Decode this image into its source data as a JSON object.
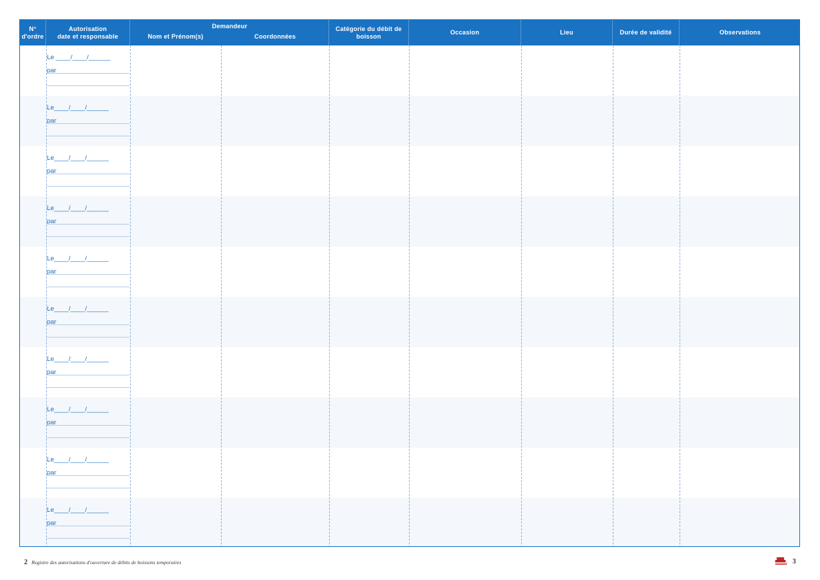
{
  "header": {
    "num": [
      "N°",
      "d'ordre"
    ],
    "autorisation": [
      "Autorisation",
      "date et responsable"
    ],
    "demandeur": "Demandeur",
    "nom": "Nom et Prénom(s)",
    "coordonnees": "Coordonnées",
    "categorie": [
      "Catégorie du débit de",
      "boisson"
    ],
    "occasion": "Occasion",
    "lieu": "Lieu",
    "duree": "Durée de validité",
    "observations": "Observations"
  },
  "rows": [
    {
      "le": "Le ____/____/______",
      "par": "par"
    },
    {
      "le": "Le____/____/______",
      "par": "par"
    },
    {
      "le": "Le____/____/______",
      "par": "par"
    },
    {
      "le": "Le____/____/______",
      "par": "par"
    },
    {
      "le": "Le____/____/______",
      "par": "par"
    },
    {
      "le": "Le____/____/______",
      "par": "par"
    },
    {
      "le": "Le____/____/______",
      "par": "par"
    },
    {
      "le": "Le____/____/______",
      "par": "par"
    },
    {
      "le": "Le____/____/______",
      "par": "par"
    },
    {
      "le": "Le____/____/______",
      "par": "par"
    }
  ],
  "footer": {
    "left_page": "2",
    "title": "Registre des autorisations d'ouverture de débits de boissons temporaires",
    "right_page": "3",
    "logo_icon": "publisher-logo-icon"
  },
  "colors": {
    "accent": "#1a72c2",
    "alt_row": "#f4f7fb"
  }
}
